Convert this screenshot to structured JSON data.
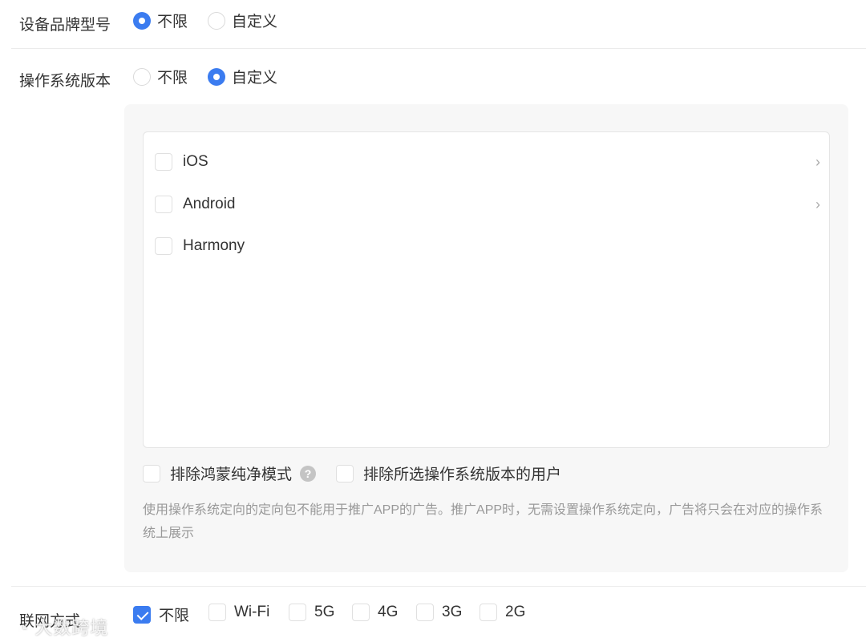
{
  "device_brand": {
    "label": "设备品牌型号",
    "options": [
      {
        "label": "不限",
        "selected": true
      },
      {
        "label": "自定义",
        "selected": false
      }
    ]
  },
  "os_version": {
    "label": "操作系统版本",
    "options": [
      {
        "label": "不限",
        "selected": false
      },
      {
        "label": "自定义",
        "selected": true
      }
    ],
    "os_list": [
      {
        "label": "iOS",
        "checked": false,
        "expandable": true
      },
      {
        "label": "Android",
        "checked": false,
        "expandable": true
      },
      {
        "label": "Harmony",
        "checked": false,
        "expandable": false
      }
    ],
    "exclude_harmony_pure": "排除鸿蒙纯净模式",
    "exclude_selected": "排除所选操作系统版本的用户",
    "note": "使用操作系统定向的定向包不能用于推广APP的广告。推广APP时，无需设置操作系统定向，广告将只会在对应的操作系统上展示"
  },
  "network": {
    "label": "联网方式",
    "options": [
      {
        "label": "不限",
        "checked": true
      },
      {
        "label": "Wi-Fi",
        "checked": false
      },
      {
        "label": "5G",
        "checked": false
      },
      {
        "label": "4G",
        "checked": false
      },
      {
        "label": "3G",
        "checked": false
      },
      {
        "label": "2G",
        "checked": false
      }
    ]
  },
  "watermark": "大数跨境",
  "colors": {
    "accent": "#3b7cf0"
  }
}
